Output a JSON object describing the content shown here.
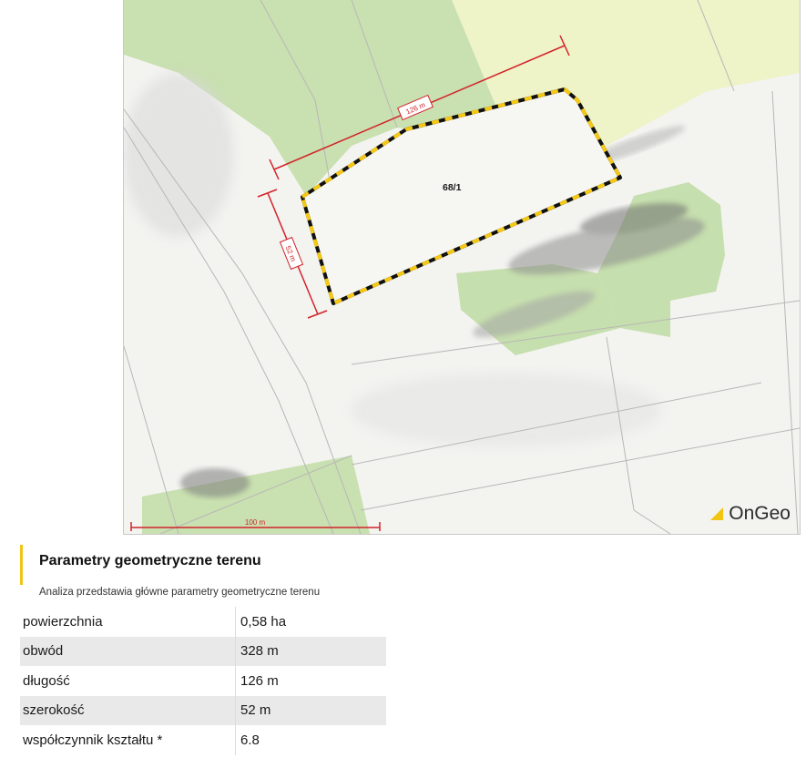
{
  "map": {
    "parcel_label": "68/1",
    "dimension_length": "126 m",
    "dimension_width": "52 m",
    "scale_bar_label": "100 m",
    "logo_text": "OnGeo",
    "colors": {
      "parcel_outline": "#111111",
      "parcel_dash": "#f4c814",
      "dimension": "#d2232a",
      "green_area": "#c6dfae",
      "yellow_area": "#eef3c8"
    }
  },
  "section": {
    "title": "Parametry geometryczne terenu",
    "subtitle": "Analiza przedstawia główne parametry geometryczne terenu",
    "accent_color": "#f0c419"
  },
  "params": [
    {
      "label": "powierzchnia",
      "value": "0,58 ha"
    },
    {
      "label": "obwód",
      "value": "328 m"
    },
    {
      "label": "długość",
      "value": "126 m"
    },
    {
      "label": "szerokość",
      "value": "52 m"
    },
    {
      "label": "współczynnik kształtu *",
      "value": "6.8"
    }
  ]
}
